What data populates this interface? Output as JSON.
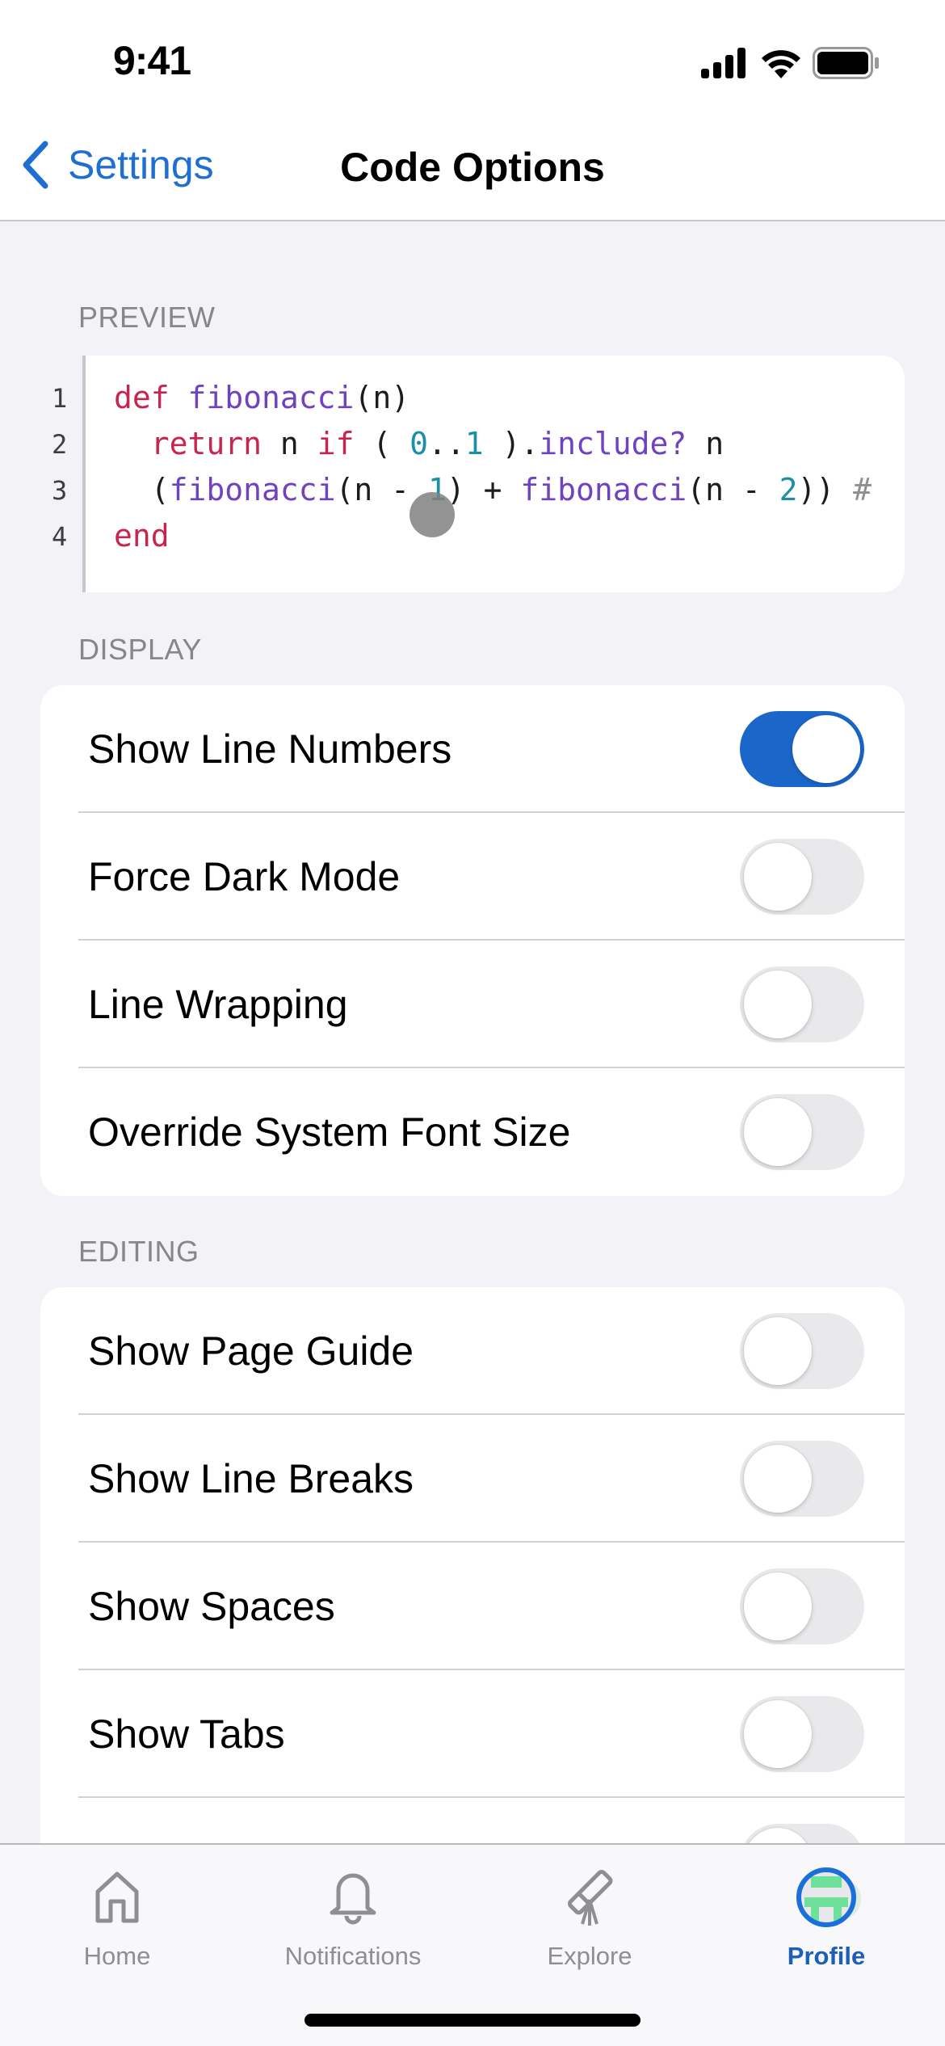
{
  "status_bar": {
    "time": "9:41",
    "icons": [
      "cellular-signal-icon",
      "wifi-icon",
      "battery-icon"
    ]
  },
  "nav": {
    "back_label": "Settings",
    "title": "Code Options"
  },
  "preview": {
    "header": "PREVIEW",
    "line_numbers": [
      "1",
      "2",
      "3",
      "4"
    ],
    "lines": [
      [
        {
          "t": "def",
          "c": "kw"
        },
        {
          "t": " "
        },
        {
          "t": "fibonacci",
          "c": "fn"
        },
        {
          "t": "(n)"
        }
      ],
      [
        {
          "t": "  "
        },
        {
          "t": "return",
          "c": "kw"
        },
        {
          "t": " n "
        },
        {
          "t": "if",
          "c": "kw"
        },
        {
          "t": " ( "
        },
        {
          "t": "0",
          "c": "num"
        },
        {
          "t": ".."
        },
        {
          "t": "1",
          "c": "num"
        },
        {
          "t": " )."
        },
        {
          "t": "include?",
          "c": "fn"
        },
        {
          "t": " n"
        }
      ],
      [
        {
          "t": "  ("
        },
        {
          "t": "fibonacci",
          "c": "fn"
        },
        {
          "t": "(n - "
        },
        {
          "t": "1",
          "c": "num"
        },
        {
          "t": ") + "
        },
        {
          "t": "fibonacci",
          "c": "fn"
        },
        {
          "t": "(n - "
        },
        {
          "t": "2",
          "c": "num"
        },
        {
          "t": ")) "
        },
        {
          "t": "#",
          "c": "cm"
        }
      ],
      [
        {
          "t": "end",
          "c": "kw"
        }
      ]
    ]
  },
  "display": {
    "header": "DISPLAY",
    "items": [
      {
        "label": "Show Line Numbers",
        "on": true
      },
      {
        "label": "Force Dark Mode",
        "on": false
      },
      {
        "label": "Line Wrapping",
        "on": false
      },
      {
        "label": "Override System Font Size",
        "on": false
      }
    ]
  },
  "editing": {
    "header": "EDITING",
    "items": [
      {
        "label": "Show Page Guide",
        "on": false
      },
      {
        "label": "Show Line Breaks",
        "on": false
      },
      {
        "label": "Show Spaces",
        "on": false
      },
      {
        "label": "Show Tabs",
        "on": false
      },
      {
        "label": "",
        "on": false
      }
    ]
  },
  "tabbar": {
    "tabs": [
      {
        "label": "Home",
        "icon": "home-icon",
        "active": false
      },
      {
        "label": "Notifications",
        "icon": "bell-icon",
        "active": false
      },
      {
        "label": "Explore",
        "icon": "telescope-icon",
        "active": false
      },
      {
        "label": "Profile",
        "icon": "profile-avatar-icon",
        "active": true
      }
    ]
  },
  "colors": {
    "accent": "#1b66c9",
    "link": "#1f6fd1",
    "keyword": "#c7254e",
    "function": "#6f42c1",
    "number": "#1a8fa6"
  }
}
